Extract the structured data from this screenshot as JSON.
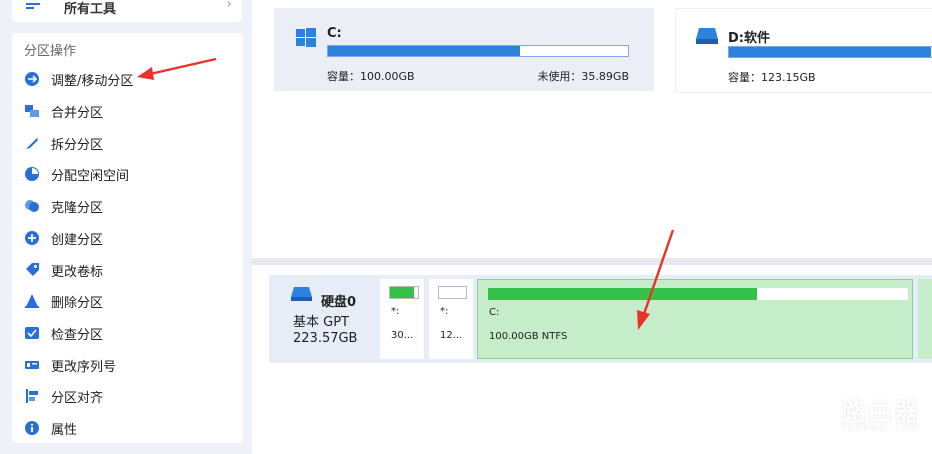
{
  "top_nav": {
    "label": "所有工具",
    "chevron": "›"
  },
  "partition_ops": {
    "title": "分区操作",
    "items": [
      {
        "label": "调整/移动分区",
        "icon": "resize-partition-icon"
      },
      {
        "label": "合并分区",
        "icon": "merge-partition-icon"
      },
      {
        "label": "拆分分区",
        "icon": "split-partition-icon"
      },
      {
        "label": "分配空闲空间",
        "icon": "allocate-space-icon"
      },
      {
        "label": "克隆分区",
        "icon": "clone-partition-icon"
      },
      {
        "label": "创建分区",
        "icon": "create-partition-icon"
      },
      {
        "label": "更改卷标",
        "icon": "change-label-icon"
      },
      {
        "label": "删除分区",
        "icon": "delete-partition-icon"
      },
      {
        "label": "检查分区",
        "icon": "check-partition-icon"
      },
      {
        "label": "更改序列号",
        "icon": "change-serial-icon"
      },
      {
        "label": "分区对齐",
        "icon": "align-partition-icon"
      },
      {
        "label": "属性",
        "icon": "properties-icon"
      }
    ]
  },
  "drives": {
    "c": {
      "name": "C:",
      "capacity": "容量：100.00GB",
      "unused": "未使用：35.89GB",
      "used_fraction": 0.64
    },
    "d": {
      "name": "D:软件",
      "capacity": "容量：123.15GB",
      "used_fraction": 0.98
    }
  },
  "disk": {
    "name": "硬盘0",
    "type": "基本 GPT",
    "size": "223.57GB",
    "partitions": [
      {
        "letter": "*:",
        "size": "30...",
        "used_fraction": 0.85
      },
      {
        "letter": "*:",
        "size": "12...",
        "used_fraction": 0.0
      },
      {
        "letter": "C:",
        "size": "100.00GB NTFS",
        "used_fraction": 0.64
      }
    ]
  },
  "colors": {
    "accent": "#2c82dc",
    "green": "#34c149",
    "arrow": "#e8332a"
  },
  "watermark": {
    "title": "路由器",
    "subtitle": "luyouqi.com"
  }
}
